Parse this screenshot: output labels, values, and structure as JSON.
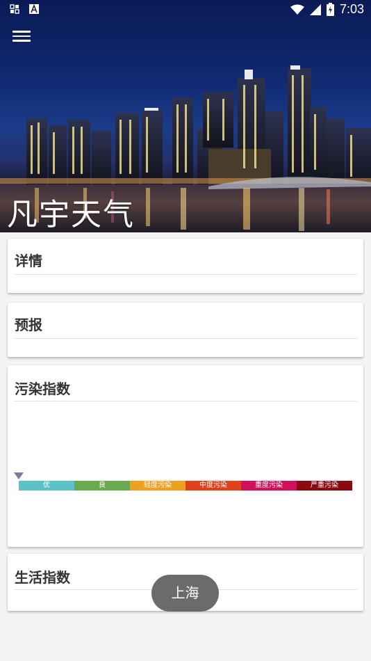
{
  "status_bar": {
    "time": "7:03"
  },
  "app": {
    "title": "凡宇天气"
  },
  "cards": {
    "details": {
      "title": "详情"
    },
    "forecast": {
      "title": "预报"
    },
    "pollution": {
      "title": "污染指数",
      "scale": [
        {
          "label": "优",
          "color": "#5bc0c8"
        },
        {
          "label": "良",
          "color": "#6aaa4e"
        },
        {
          "label": "轻度污染",
          "color": "#f0a020"
        },
        {
          "label": "中度污染",
          "color": "#e0401a"
        },
        {
          "label": "重度污染",
          "color": "#d0105a"
        },
        {
          "label": "严重污染",
          "color": "#8a0a10"
        }
      ]
    },
    "life": {
      "title": "生活指数"
    }
  },
  "toast": {
    "text": "上海"
  },
  "icons": [
    "notification-icon",
    "font-icon",
    "wifi-icon",
    "signal-icon",
    "battery-icon",
    "menu-icon"
  ]
}
